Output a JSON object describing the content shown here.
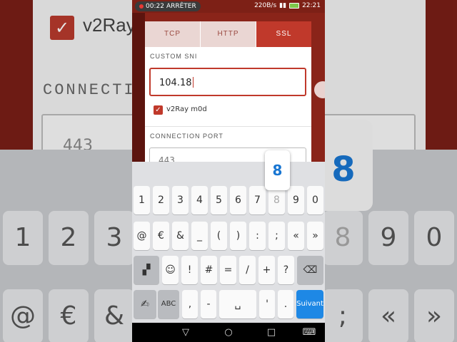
{
  "status_bar": {
    "rec_time": "00:22",
    "rec_action": "ARRÊTER",
    "net_speed": "220B/s",
    "clock": "22:21"
  },
  "background": {
    "app_title_partial": "v2Ray",
    "section_partial": "CONNECTION",
    "port_partial": "443",
    "popup_digit": "8"
  },
  "dialog": {
    "tabs": [
      {
        "label": "TCP",
        "active": false
      },
      {
        "label": "HTTP",
        "active": false
      },
      {
        "label": "SSL",
        "active": true
      }
    ],
    "custom_sni_label": "CUSTOM SNI",
    "custom_sni_value": "104.18",
    "checkbox_label": "v2Ray m0d",
    "checkbox_checked": true,
    "connection_port_label": "CONNECTION PORT",
    "connection_port_value": "443"
  },
  "keyboard": {
    "popup_key": "8",
    "row1": [
      "1",
      "2",
      "3",
      "4",
      "5",
      "6",
      "7",
      "8",
      "9",
      "0"
    ],
    "row2": [
      "@",
      "€",
      "&",
      "_",
      "(",
      ")",
      ":",
      ";",
      "«",
      "»"
    ],
    "row3": [
      "☺",
      "!",
      "#",
      "=",
      "/",
      "+",
      "?"
    ],
    "abc_label": "ABC",
    "comma": ",",
    "dash": "-",
    "apostrophe": "'",
    "period": ".",
    "action_label": "Suivant",
    "accent_color": "#1e88e5"
  },
  "theme": {
    "primary": "#c0392b",
    "primary_dark": "#7d2016"
  }
}
